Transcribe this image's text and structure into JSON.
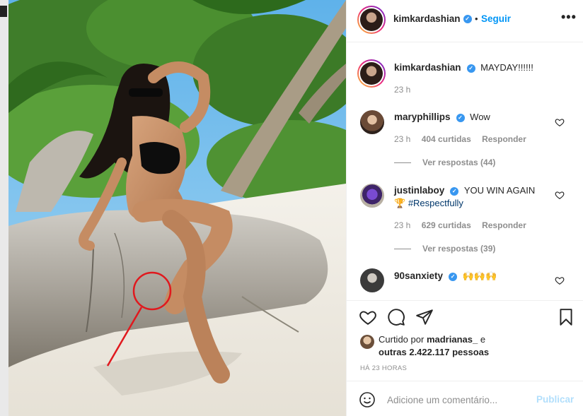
{
  "post": {
    "username": "kimkardashian",
    "verified_icon": "verified-badge-icon",
    "follow_label": "Seguir",
    "dot": "•",
    "more_label": "•••"
  },
  "caption": {
    "username": "kimkardashian",
    "text": "MAYDAY!!!!!!",
    "time": "23 h"
  },
  "comments": [
    {
      "username": "maryphillips",
      "text": "Wow",
      "time": "23 h",
      "likes": "404 curtidas",
      "reply_label": "Responder",
      "view_replies": "Ver respostas (44)"
    },
    {
      "username": "justinlaboy",
      "text": "YOU WIN AGAIN",
      "text2_emoji": "🏆",
      "hashtag": "#Respectfully",
      "time": "23 h",
      "likes": "629 curtidas",
      "reply_label": "Responder",
      "view_replies": "Ver respostas (39)"
    },
    {
      "username": "90sanxiety",
      "text": "🙌🙌🙌"
    }
  ],
  "likes": {
    "prefix": "Curtido por",
    "user": "madrianas_",
    "conj": "e",
    "others": "outras 2.422.117 pessoas"
  },
  "timestamp": "HÁ 23 HORAS",
  "add_comment": {
    "placeholder": "Adicione um comentário...",
    "publish_label": "Publicar"
  },
  "colors": {
    "accent": "#0095f6",
    "verified": "#3897f0",
    "publish_disabled": "#b2dffc",
    "annotation": "#e0191e"
  }
}
